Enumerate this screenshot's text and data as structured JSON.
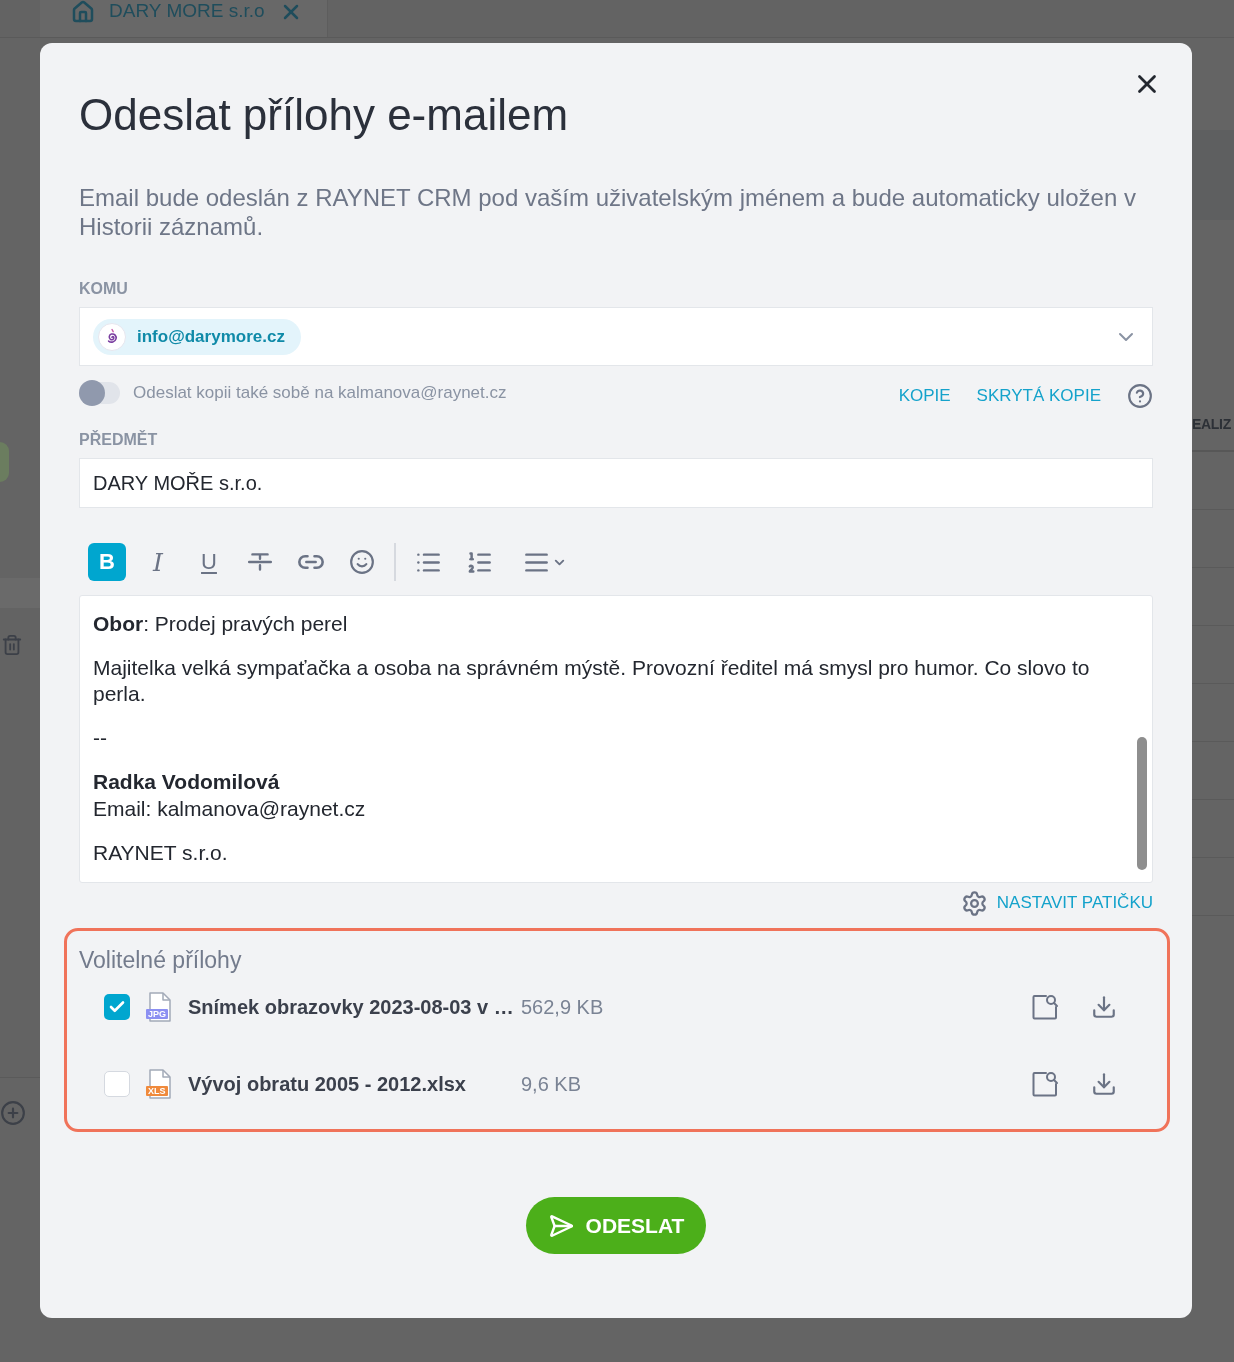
{
  "background": {
    "tab": {
      "label": "DARY MORE s.r.o"
    },
    "table": {
      "column_1": "EALIZ"
    }
  },
  "dialog": {
    "title": "Odeslat přílohy e-mailem",
    "description": "Email bude odeslán z RAYNET CRM pod vaším uživatelským jménem a bude automaticky uložen v Historii záznamů.",
    "recipient_field": {
      "label": "KOMU",
      "recipients": [
        {
          "email": "info@darymore.cz"
        }
      ]
    },
    "copy_to_self": {
      "label": "Odeslat kopii také sobě na kalmanova@raynet.cz",
      "on": false
    },
    "copy_links": [
      "KOPIE",
      "SKRYTÁ KOPIE"
    ],
    "subject": {
      "label": "PŘEDMĚT",
      "value": "DARY MOŘE s.r.o."
    },
    "toolbar": [
      {
        "kind": "bold",
        "label": "B",
        "selected": true
      },
      {
        "kind": "italic",
        "label": "I",
        "selected": false
      },
      {
        "kind": "underline",
        "label": "U",
        "selected": false
      },
      {
        "kind": "strikethrough",
        "selected": false
      },
      {
        "kind": "link",
        "selected": false
      },
      {
        "kind": "emoji",
        "selected": false
      },
      {
        "kind": "bullet_list",
        "selected": false
      },
      {
        "kind": "numbered_list",
        "selected": false
      },
      {
        "kind": "align",
        "selected": false
      }
    ],
    "body": {
      "paragraphs": [
        "**Obor**: Prodej pravých perel",
        "Majitelka velká sympaťačka a osoba na správném mýstě. Provozní ředitel má smysl pro humor. Co slovo to perla.",
        "--"
      ],
      "signature": {
        "name": "Radka Vodomilová",
        "lines": [
          "Email: kalmanova@raynet.cz"
        ],
        "company": "RAYNET s.r.o."
      }
    },
    "footer_link": "NASTAVIT PATIČKU",
    "attachments": {
      "title": "Volitelné přílohy",
      "items": [
        {
          "name": "Snímek obrazovky 2023-08-03 v …",
          "size": "562,9 KB",
          "type": "JPG",
          "color": "#8c90f2",
          "checked": true
        },
        {
          "name": "Vývoj obratu 2005 - 2012.xlsx",
          "size": "9,6 KB",
          "type": "XLS",
          "color": "#f08a3c",
          "checked": false
        }
      ]
    },
    "send_button": "ODESLAT"
  }
}
